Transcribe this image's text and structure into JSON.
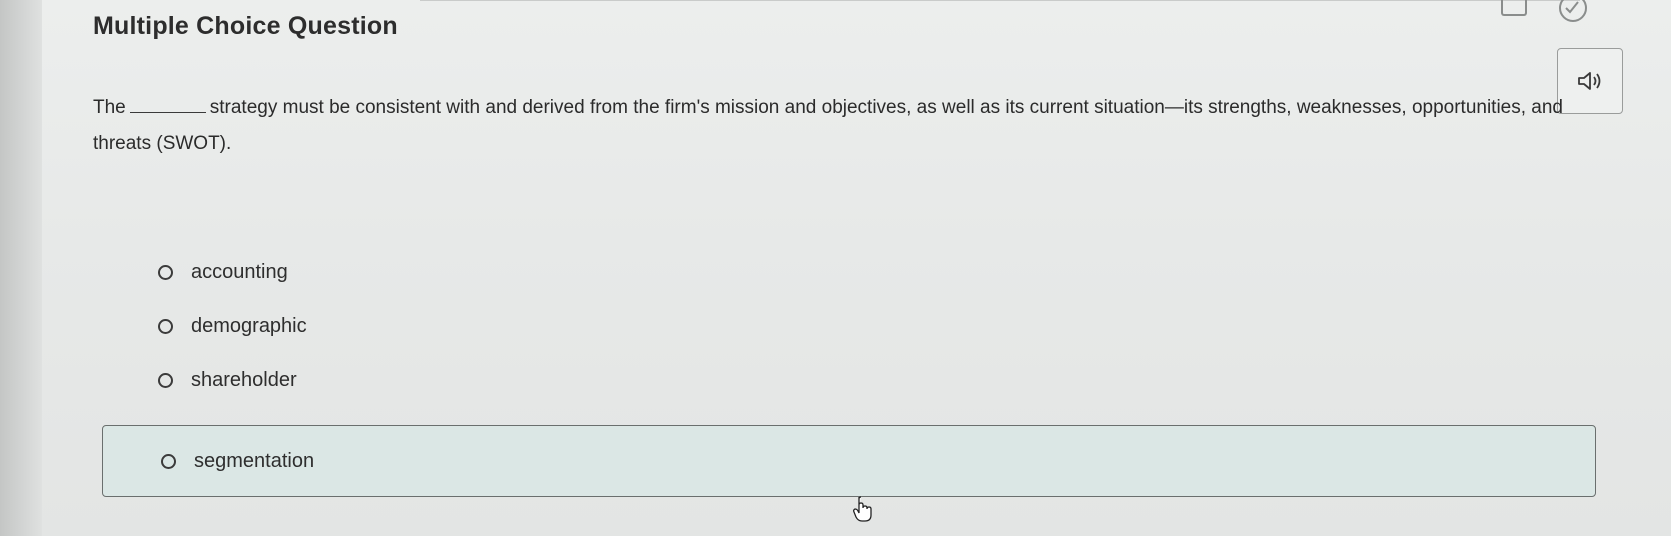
{
  "question": {
    "title": "Multiple Choice Question",
    "stem_start": "The",
    "stem_end": "strategy must be consistent with and derived from the firm's mission and objectives, as well as its current situation—its strengths, weaknesses, opportunities, and threats (SWOT)."
  },
  "options": [
    {
      "label": "accounting",
      "selected": false
    },
    {
      "label": "demographic",
      "selected": false
    },
    {
      "label": "shareholder",
      "selected": false
    },
    {
      "label": "segmentation",
      "selected": false,
      "highlighted": true
    }
  ],
  "icons": {
    "audio": "speaker-icon",
    "calculator": "calculator-icon",
    "check": "check-circle-icon",
    "cursor": "hand-pointer-icon"
  },
  "colors": {
    "highlight_bg": "#dbe7e5",
    "text": "#2b2b2b"
  }
}
